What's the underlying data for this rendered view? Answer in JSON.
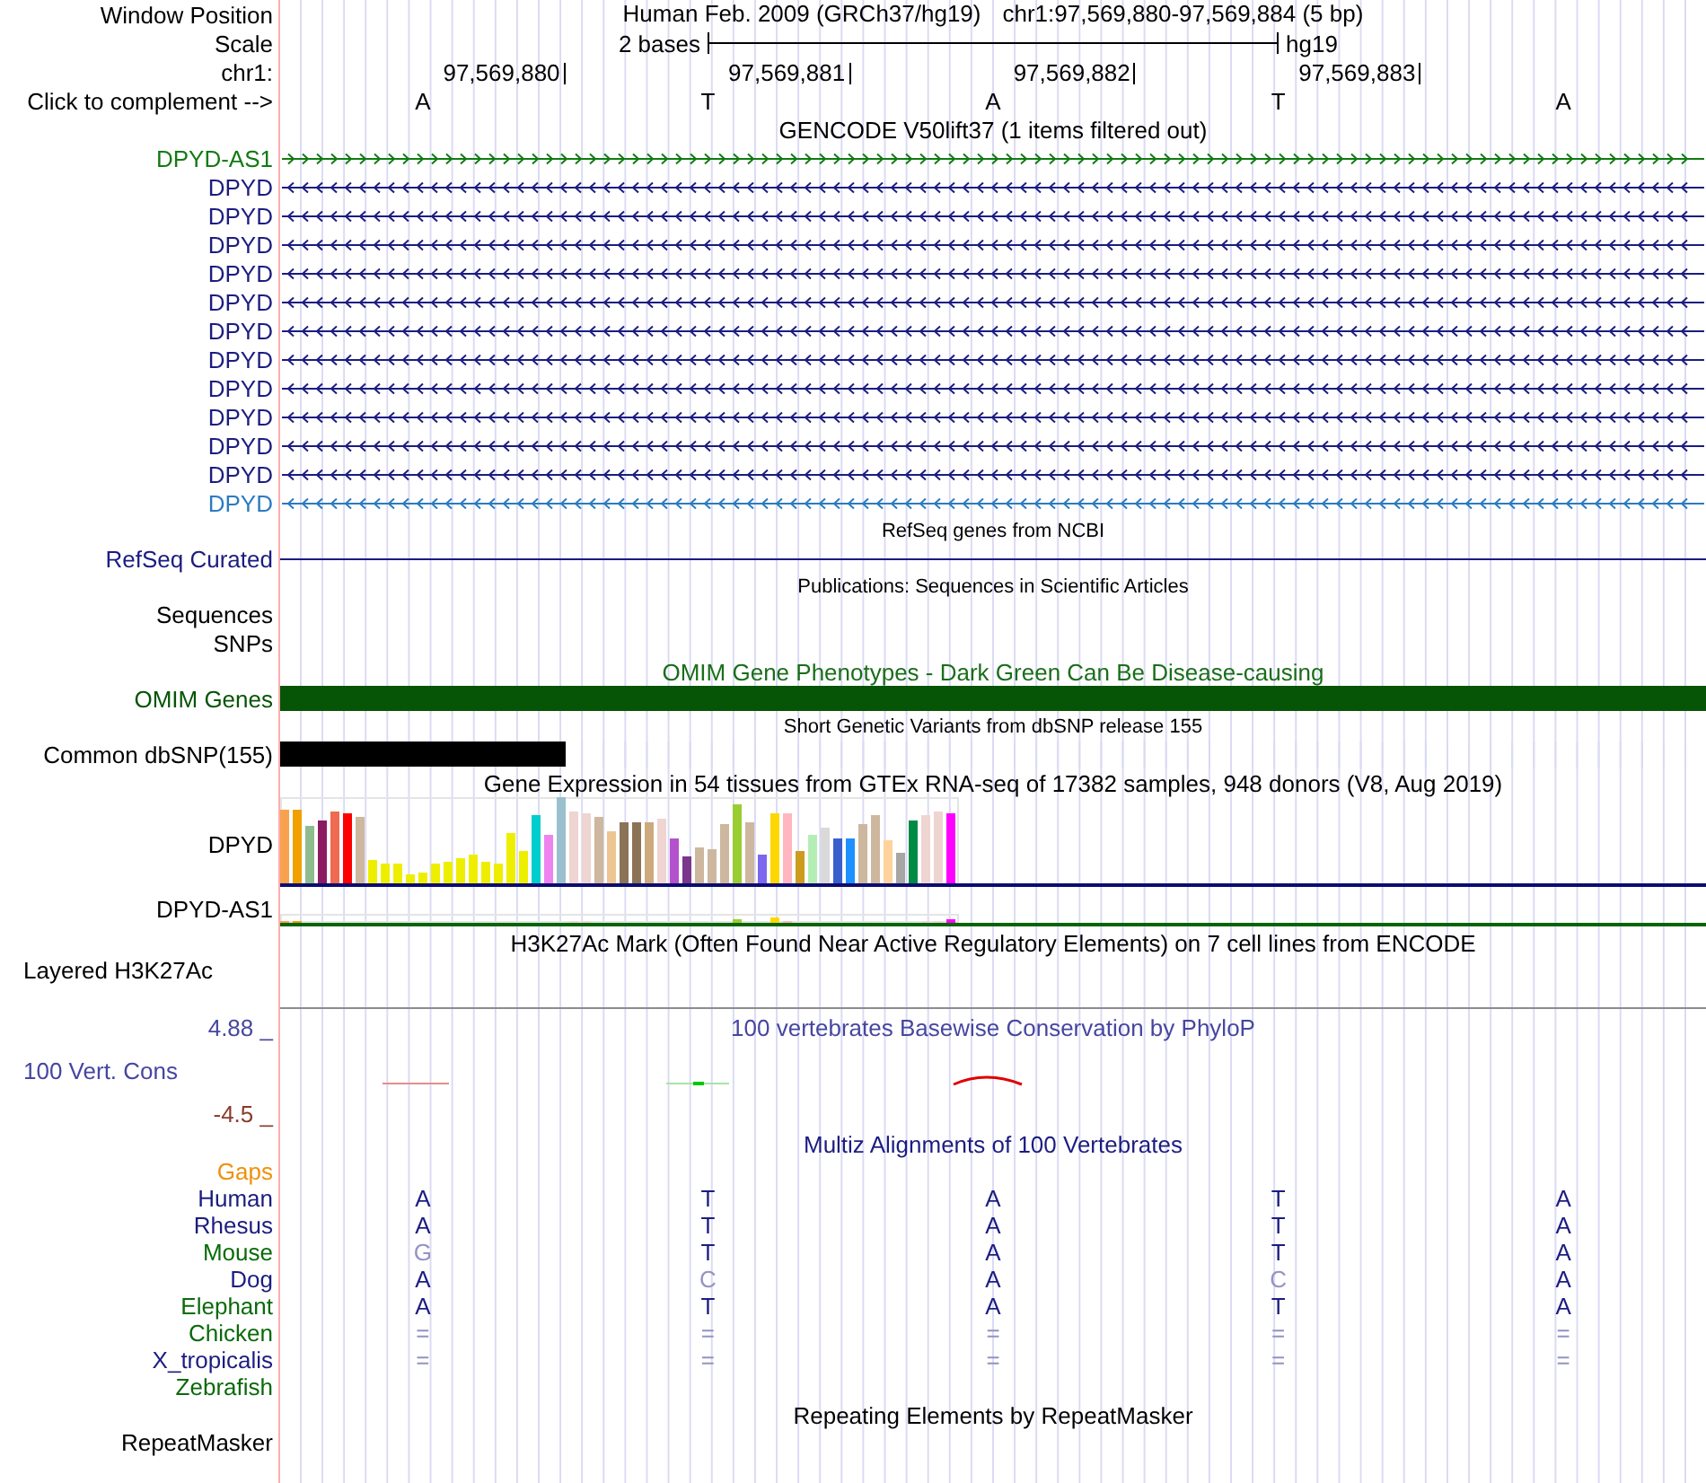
{
  "header": {
    "label": "Window Position",
    "assembly": "Human Feb. 2009 (GRCh37/hg19)",
    "range": "chr1:97,569,880-97,569,884 (5 bp)"
  },
  "scale": {
    "label": "Scale",
    "span": "2 bases",
    "assembly": "hg19"
  },
  "ruler": {
    "label": "chr1:",
    "positions": [
      "97,569,880",
      "97,569,881",
      "97,569,882",
      "97,569,883"
    ]
  },
  "sequence": {
    "label": "Click to complement -->",
    "bases": [
      "A",
      "T",
      "A",
      "T",
      "A"
    ]
  },
  "tracks": [
    {
      "kind": "genes",
      "title": "GENCODE V50lift37 (1 items filtered out)",
      "rows": [
        {
          "label": "DPYD-AS1",
          "color": "#127a12",
          "reverse": false
        },
        {
          "label": "DPYD",
          "color": "#1c1c80",
          "reverse": true
        },
        {
          "label": "DPYD",
          "color": "#1c1c80",
          "reverse": true
        },
        {
          "label": "DPYD",
          "color": "#1c1c80",
          "reverse": true
        },
        {
          "label": "DPYD",
          "color": "#1c1c80",
          "reverse": true
        },
        {
          "label": "DPYD",
          "color": "#1c1c80",
          "reverse": true
        },
        {
          "label": "DPYD",
          "color": "#1c1c80",
          "reverse": true
        },
        {
          "label": "DPYD",
          "color": "#1c1c80",
          "reverse": true
        },
        {
          "label": "DPYD",
          "color": "#1c1c80",
          "reverse": true
        },
        {
          "label": "DPYD",
          "color": "#1c1c80",
          "reverse": true
        },
        {
          "label": "DPYD",
          "color": "#1c1c80",
          "reverse": true
        },
        {
          "label": "DPYD",
          "color": "#1c1c80",
          "reverse": true
        },
        {
          "label": "DPYD",
          "color": "#2b7bbf",
          "reverse": true
        }
      ]
    },
    {
      "kind": "refseq",
      "title": "RefSeq genes from NCBI",
      "rows": [
        {
          "label": "RefSeq Curated",
          "color": "#1c1c80"
        }
      ]
    },
    {
      "kind": "publications",
      "title": "Publications: Sequences in Scientific Articles",
      "rows": [
        {
          "label": "Sequences"
        },
        {
          "label": "SNPs"
        }
      ]
    },
    {
      "kind": "phenotypes",
      "title": "OMIM Gene Phenotypes - Dark Green Can Be Disease-causing",
      "color": "#1a6e1a",
      "rows": [
        {
          "label": "OMIM Genes",
          "color": "#065406",
          "level": 1
        }
      ]
    },
    {
      "kind": "variants",
      "title": "Short Genetic Variants from dbSNP release 155",
      "rows": [
        {
          "label": "Common dbSNP(155)",
          "color": "#000000",
          "level": 0.2
        }
      ]
    },
    {
      "kind": "expression",
      "title": "Gene Expression in 54 tissues from GTEx RNA-seq of 17382 samples, 948 donors (V8, Aug 2019)",
      "rows": [
        {
          "label": "DPYD"
        },
        {
          "label": "DPYD-AS1"
        }
      ]
    },
    {
      "kind": "signal",
      "title": "H3K27Ac Mark (Often Found Near Active Regulatory Elements) on 7 cell lines from ENCODE",
      "rows": [
        {
          "label": "Layered H3K27Ac"
        }
      ]
    },
    {
      "kind": "conservation",
      "title": "100 vertebrates Basewise Conservation by PhyloP",
      "color": "#4646a0",
      "rows": [
        {
          "label": "4.88 _",
          "color": "#4646a0"
        },
        {
          "label": "100 Vert. Cons",
          "color": "#4646a0"
        },
        {
          "label": "-4.5 _",
          "color": "#8b3a2a"
        }
      ]
    },
    {
      "kind": "alignment",
      "title": "Multiz Alignments of 100 Vertebrates",
      "color": "#1c1c80",
      "rows": [
        {
          "label": "Gaps",
          "color": "#f0900a"
        },
        {
          "label": "Human",
          "color": "#1c1c80",
          "bases": [
            {
              "letter": "A",
              "faint": false
            },
            {
              "letter": "T",
              "faint": false
            },
            {
              "letter": "A",
              "faint": false
            },
            {
              "letter": "T",
              "faint": false
            },
            {
              "letter": "A",
              "faint": false
            }
          ]
        },
        {
          "label": "Rhesus",
          "color": "#1c1c80",
          "bases": [
            {
              "letter": "A",
              "faint": false
            },
            {
              "letter": "T",
              "faint": false
            },
            {
              "letter": "A",
              "faint": false
            },
            {
              "letter": "T",
              "faint": false
            },
            {
              "letter": "A",
              "faint": false
            }
          ]
        },
        {
          "label": "Mouse",
          "color": "#0a6a0a",
          "bases": [
            {
              "letter": "G",
              "faint": true
            },
            {
              "letter": "T",
              "faint": false
            },
            {
              "letter": "A",
              "faint": false
            },
            {
              "letter": "T",
              "faint": false
            },
            {
              "letter": "A",
              "faint": false
            }
          ]
        },
        {
          "label": "Dog",
          "color": "#1c1c80",
          "bases": [
            {
              "letter": "A",
              "faint": false
            },
            {
              "letter": "C",
              "faint": true
            },
            {
              "letter": "A",
              "faint": false
            },
            {
              "letter": "C",
              "faint": true
            },
            {
              "letter": "A",
              "faint": false
            }
          ]
        },
        {
          "label": "Elephant",
          "color": "#0a6a0a",
          "bases": [
            {
              "letter": "A",
              "faint": false
            },
            {
              "letter": "T",
              "faint": false
            },
            {
              "letter": "A",
              "faint": false
            },
            {
              "letter": "T",
              "faint": false
            },
            {
              "letter": "A",
              "faint": false
            }
          ]
        },
        {
          "label": "Chicken",
          "color": "#0a6a0a",
          "bases": [
            {
              "letter": "=",
              "faint": true
            },
            {
              "letter": "=",
              "faint": true
            },
            {
              "letter": "=",
              "faint": true
            },
            {
              "letter": "=",
              "faint": true
            },
            {
              "letter": "=",
              "faint": true
            }
          ]
        },
        {
          "label": "X_tropicalis",
          "color": "#1c1c80",
          "bases": [
            {
              "letter": "=",
              "faint": true
            },
            {
              "letter": "=",
              "faint": true
            },
            {
              "letter": "=",
              "faint": true
            },
            {
              "letter": "=",
              "faint": true
            },
            {
              "letter": "=",
              "faint": true
            }
          ]
        },
        {
          "label": "Zebrafish",
          "color": "#0a6a0a"
        }
      ]
    },
    {
      "kind": "repeats",
      "title": "Repeating Elements by RepeatMasker",
      "rows": [
        {
          "label": "RepeatMasker"
        }
      ]
    }
  ]
}
